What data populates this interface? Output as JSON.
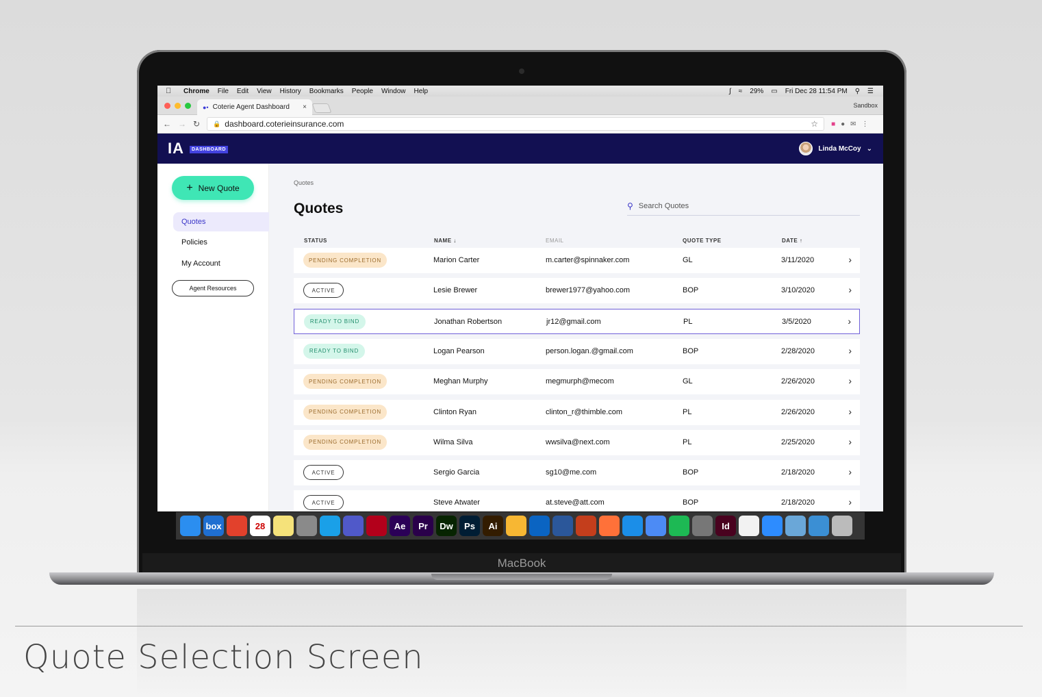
{
  "menubar": {
    "app": "Chrome",
    "items": [
      "File",
      "Edit",
      "View",
      "History",
      "Bookmarks",
      "People",
      "Window",
      "Help"
    ],
    "battery": "29%",
    "datetime": "Fri Dec 28  11:54 PM"
  },
  "browser": {
    "tab_title": "Coterie Agent Dashboard",
    "profile": "Sandbox",
    "url": "dashboard.coterieinsurance.com"
  },
  "app": {
    "logo": "IA",
    "badge": "DASHBOARD",
    "user_name": "Linda McCoy"
  },
  "sidebar": {
    "new_quote": "New Quote",
    "items": [
      "Quotes",
      "Policies",
      "My Account"
    ],
    "resources": "Agent Resources"
  },
  "main": {
    "breadcrumb": "Quotes",
    "title": "Quotes",
    "search_placeholder": "Search Quotes",
    "columns": [
      "STATUS",
      "NAME ↓",
      "EMAIL",
      "QUOTE TYPE",
      "DATE ↑"
    ],
    "rows": [
      {
        "status": "PENDING COMPLETION",
        "kind": "pending",
        "name": "Marion Carter",
        "email": "m.carter@spinnaker.com",
        "type": "GL",
        "date": "3/11/2020"
      },
      {
        "status": "ACTIVE",
        "kind": "active",
        "name": "Lesie Brewer",
        "email": "brewer1977@yahoo.com",
        "type": "BOP",
        "date": "3/10/2020"
      },
      {
        "status": "READY TO BIND",
        "kind": "ready",
        "name": "Jonathan Robertson",
        "email": "jr12@gmail.com",
        "type": "PL",
        "date": "3/5/2020"
      },
      {
        "status": "READY TO BIND",
        "kind": "ready",
        "name": "Logan Pearson",
        "email": "person.logan.@gmail.com",
        "type": "BOP",
        "date": "2/28/2020"
      },
      {
        "status": "PENDING COMPLETION",
        "kind": "pending",
        "name": "Meghan Murphy",
        "email": "megmurph@mecom",
        "type": "GL",
        "date": "2/26/2020"
      },
      {
        "status": "PENDING COMPLETION",
        "kind": "pending",
        "name": "Clinton Ryan",
        "email": "clinton_r@thimble.com",
        "type": "PL",
        "date": "2/26/2020"
      },
      {
        "status": "PENDING COMPLETION",
        "kind": "pending",
        "name": "Wilma Silva",
        "email": "wwsilva@next.com",
        "type": "PL",
        "date": "2/25/2020"
      },
      {
        "status": "ACTIVE",
        "kind": "active",
        "name": "Sergio Garcia",
        "email": "sg10@me.com",
        "type": "BOP",
        "date": "2/18/2020"
      },
      {
        "status": "ACTIVE",
        "kind": "active",
        "name": "Steve Atwater",
        "email": "at.steve@att.com",
        "type": "BOP",
        "date": "2/18/2020"
      }
    ],
    "selected_row": 2
  },
  "dock": {
    "apps": [
      "finder",
      "box",
      "wunderlist",
      "calendar",
      "stickies",
      "launchpad",
      "skype",
      "teams",
      "acrobat",
      "Ae",
      "Pr",
      "Dw",
      "Ps",
      "Ai",
      "sketch",
      "outlook",
      "word",
      "powerpoint",
      "firefox",
      "safari",
      "chrome",
      "spotify",
      "system-preferences",
      "Id",
      "files",
      "zoom",
      "preview",
      "mail",
      "trash"
    ],
    "calendar_day": "28"
  },
  "device": {
    "label": "MacBook"
  },
  "caption": "Quote Selection Screen",
  "colors": {
    "appbar": "#121052",
    "accent": "#3a35c8",
    "new_quote": "#3fe6b5",
    "pending_bg": "#fbe6c9",
    "ready_bg": "#d4f6ea",
    "selected_border": "#6f5fd8"
  }
}
